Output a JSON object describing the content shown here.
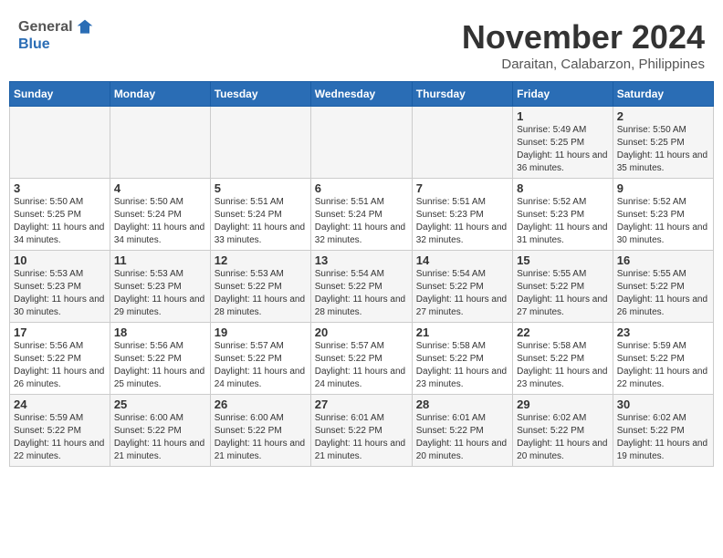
{
  "header": {
    "logo_general": "General",
    "logo_blue": "Blue",
    "month_title": "November 2024",
    "location": "Daraitan, Calabarzon, Philippines"
  },
  "days_of_week": [
    "Sunday",
    "Monday",
    "Tuesday",
    "Wednesday",
    "Thursday",
    "Friday",
    "Saturday"
  ],
  "weeks": [
    [
      {
        "day": "",
        "info": ""
      },
      {
        "day": "",
        "info": ""
      },
      {
        "day": "",
        "info": ""
      },
      {
        "day": "",
        "info": ""
      },
      {
        "day": "",
        "info": ""
      },
      {
        "day": "1",
        "info": "Sunrise: 5:49 AM\nSunset: 5:25 PM\nDaylight: 11 hours and 36 minutes."
      },
      {
        "day": "2",
        "info": "Sunrise: 5:50 AM\nSunset: 5:25 PM\nDaylight: 11 hours and 35 minutes."
      }
    ],
    [
      {
        "day": "3",
        "info": "Sunrise: 5:50 AM\nSunset: 5:25 PM\nDaylight: 11 hours and 34 minutes."
      },
      {
        "day": "4",
        "info": "Sunrise: 5:50 AM\nSunset: 5:24 PM\nDaylight: 11 hours and 34 minutes."
      },
      {
        "day": "5",
        "info": "Sunrise: 5:51 AM\nSunset: 5:24 PM\nDaylight: 11 hours and 33 minutes."
      },
      {
        "day": "6",
        "info": "Sunrise: 5:51 AM\nSunset: 5:24 PM\nDaylight: 11 hours and 32 minutes."
      },
      {
        "day": "7",
        "info": "Sunrise: 5:51 AM\nSunset: 5:23 PM\nDaylight: 11 hours and 32 minutes."
      },
      {
        "day": "8",
        "info": "Sunrise: 5:52 AM\nSunset: 5:23 PM\nDaylight: 11 hours and 31 minutes."
      },
      {
        "day": "9",
        "info": "Sunrise: 5:52 AM\nSunset: 5:23 PM\nDaylight: 11 hours and 30 minutes."
      }
    ],
    [
      {
        "day": "10",
        "info": "Sunrise: 5:53 AM\nSunset: 5:23 PM\nDaylight: 11 hours and 30 minutes."
      },
      {
        "day": "11",
        "info": "Sunrise: 5:53 AM\nSunset: 5:23 PM\nDaylight: 11 hours and 29 minutes."
      },
      {
        "day": "12",
        "info": "Sunrise: 5:53 AM\nSunset: 5:22 PM\nDaylight: 11 hours and 28 minutes."
      },
      {
        "day": "13",
        "info": "Sunrise: 5:54 AM\nSunset: 5:22 PM\nDaylight: 11 hours and 28 minutes."
      },
      {
        "day": "14",
        "info": "Sunrise: 5:54 AM\nSunset: 5:22 PM\nDaylight: 11 hours and 27 minutes."
      },
      {
        "day": "15",
        "info": "Sunrise: 5:55 AM\nSunset: 5:22 PM\nDaylight: 11 hours and 27 minutes."
      },
      {
        "day": "16",
        "info": "Sunrise: 5:55 AM\nSunset: 5:22 PM\nDaylight: 11 hours and 26 minutes."
      }
    ],
    [
      {
        "day": "17",
        "info": "Sunrise: 5:56 AM\nSunset: 5:22 PM\nDaylight: 11 hours and 26 minutes."
      },
      {
        "day": "18",
        "info": "Sunrise: 5:56 AM\nSunset: 5:22 PM\nDaylight: 11 hours and 25 minutes."
      },
      {
        "day": "19",
        "info": "Sunrise: 5:57 AM\nSunset: 5:22 PM\nDaylight: 11 hours and 24 minutes."
      },
      {
        "day": "20",
        "info": "Sunrise: 5:57 AM\nSunset: 5:22 PM\nDaylight: 11 hours and 24 minutes."
      },
      {
        "day": "21",
        "info": "Sunrise: 5:58 AM\nSunset: 5:22 PM\nDaylight: 11 hours and 23 minutes."
      },
      {
        "day": "22",
        "info": "Sunrise: 5:58 AM\nSunset: 5:22 PM\nDaylight: 11 hours and 23 minutes."
      },
      {
        "day": "23",
        "info": "Sunrise: 5:59 AM\nSunset: 5:22 PM\nDaylight: 11 hours and 22 minutes."
      }
    ],
    [
      {
        "day": "24",
        "info": "Sunrise: 5:59 AM\nSunset: 5:22 PM\nDaylight: 11 hours and 22 minutes."
      },
      {
        "day": "25",
        "info": "Sunrise: 6:00 AM\nSunset: 5:22 PM\nDaylight: 11 hours and 21 minutes."
      },
      {
        "day": "26",
        "info": "Sunrise: 6:00 AM\nSunset: 5:22 PM\nDaylight: 11 hours and 21 minutes."
      },
      {
        "day": "27",
        "info": "Sunrise: 6:01 AM\nSunset: 5:22 PM\nDaylight: 11 hours and 21 minutes."
      },
      {
        "day": "28",
        "info": "Sunrise: 6:01 AM\nSunset: 5:22 PM\nDaylight: 11 hours and 20 minutes."
      },
      {
        "day": "29",
        "info": "Sunrise: 6:02 AM\nSunset: 5:22 PM\nDaylight: 11 hours and 20 minutes."
      },
      {
        "day": "30",
        "info": "Sunrise: 6:02 AM\nSunset: 5:22 PM\nDaylight: 11 hours and 19 minutes."
      }
    ]
  ]
}
